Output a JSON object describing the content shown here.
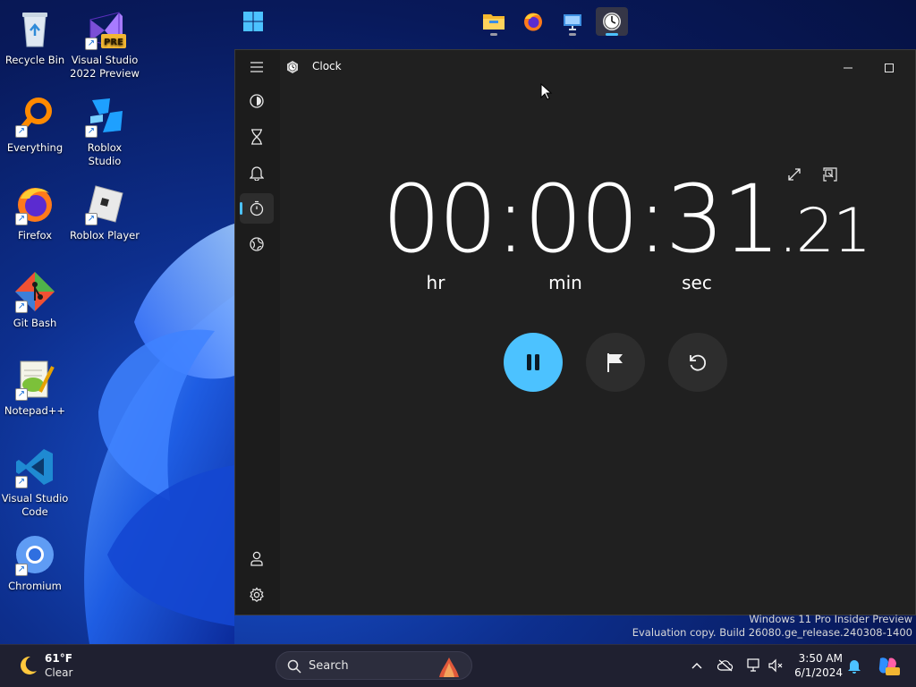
{
  "desktop": {
    "icons": [
      {
        "label": "Recycle Bin",
        "icon": "recycle-bin-icon"
      },
      {
        "label": "Visual Studio 2022 Preview",
        "icon": "visual-studio-preview-icon",
        "badge": "PRE"
      },
      {
        "label": "Everything",
        "icon": "everything-search-icon"
      },
      {
        "label": "Roblox Studio",
        "icon": "roblox-studio-icon"
      },
      {
        "label": "Firefox",
        "icon": "firefox-icon"
      },
      {
        "label": "Roblox Player",
        "icon": "roblox-player-icon"
      },
      {
        "label": "Git Bash",
        "icon": "git-bash-icon"
      },
      {
        "label": "Notepad++",
        "icon": "notepadpp-icon"
      },
      {
        "label": "Visual Studio Code",
        "icon": "vscode-icon"
      },
      {
        "label": "Chromium",
        "icon": "chromium-icon"
      }
    ]
  },
  "window": {
    "title": "Clock",
    "nav": [
      {
        "icon": "hamburger-menu-icon"
      },
      {
        "icon": "focus-sessions-icon"
      },
      {
        "icon": "timer-icon"
      },
      {
        "icon": "alarm-icon"
      },
      {
        "icon": "stopwatch-icon",
        "active": true
      },
      {
        "icon": "world-clock-icon"
      },
      {
        "icon": "account-icon"
      },
      {
        "icon": "settings-gear-icon"
      }
    ],
    "stopwatch": {
      "hours": "00",
      "minutes": "00",
      "seconds": "31",
      "fraction": ".21",
      "sep1": ":",
      "sep2": ":",
      "unit_hr": "hr",
      "unit_min": "min",
      "unit_sec": "sec"
    },
    "buttons": {
      "pause": "pause-icon",
      "lap": "flag-icon",
      "reset": "reset-icon",
      "expand": "expand-icon",
      "compact_overlay": "keep-on-top-icon"
    }
  },
  "watermark": {
    "line1": "Windows 11 Pro Insider Preview",
    "line2": "Evaluation copy. Build 26080.ge_release.240308-1400"
  },
  "taskbar": {
    "weather_temp": "61°F",
    "weather_condition": "Clear",
    "search_placeholder": "Search",
    "time": "3:50 AM",
    "date": "6/1/2024",
    "accent": "#4cc2ff"
  }
}
